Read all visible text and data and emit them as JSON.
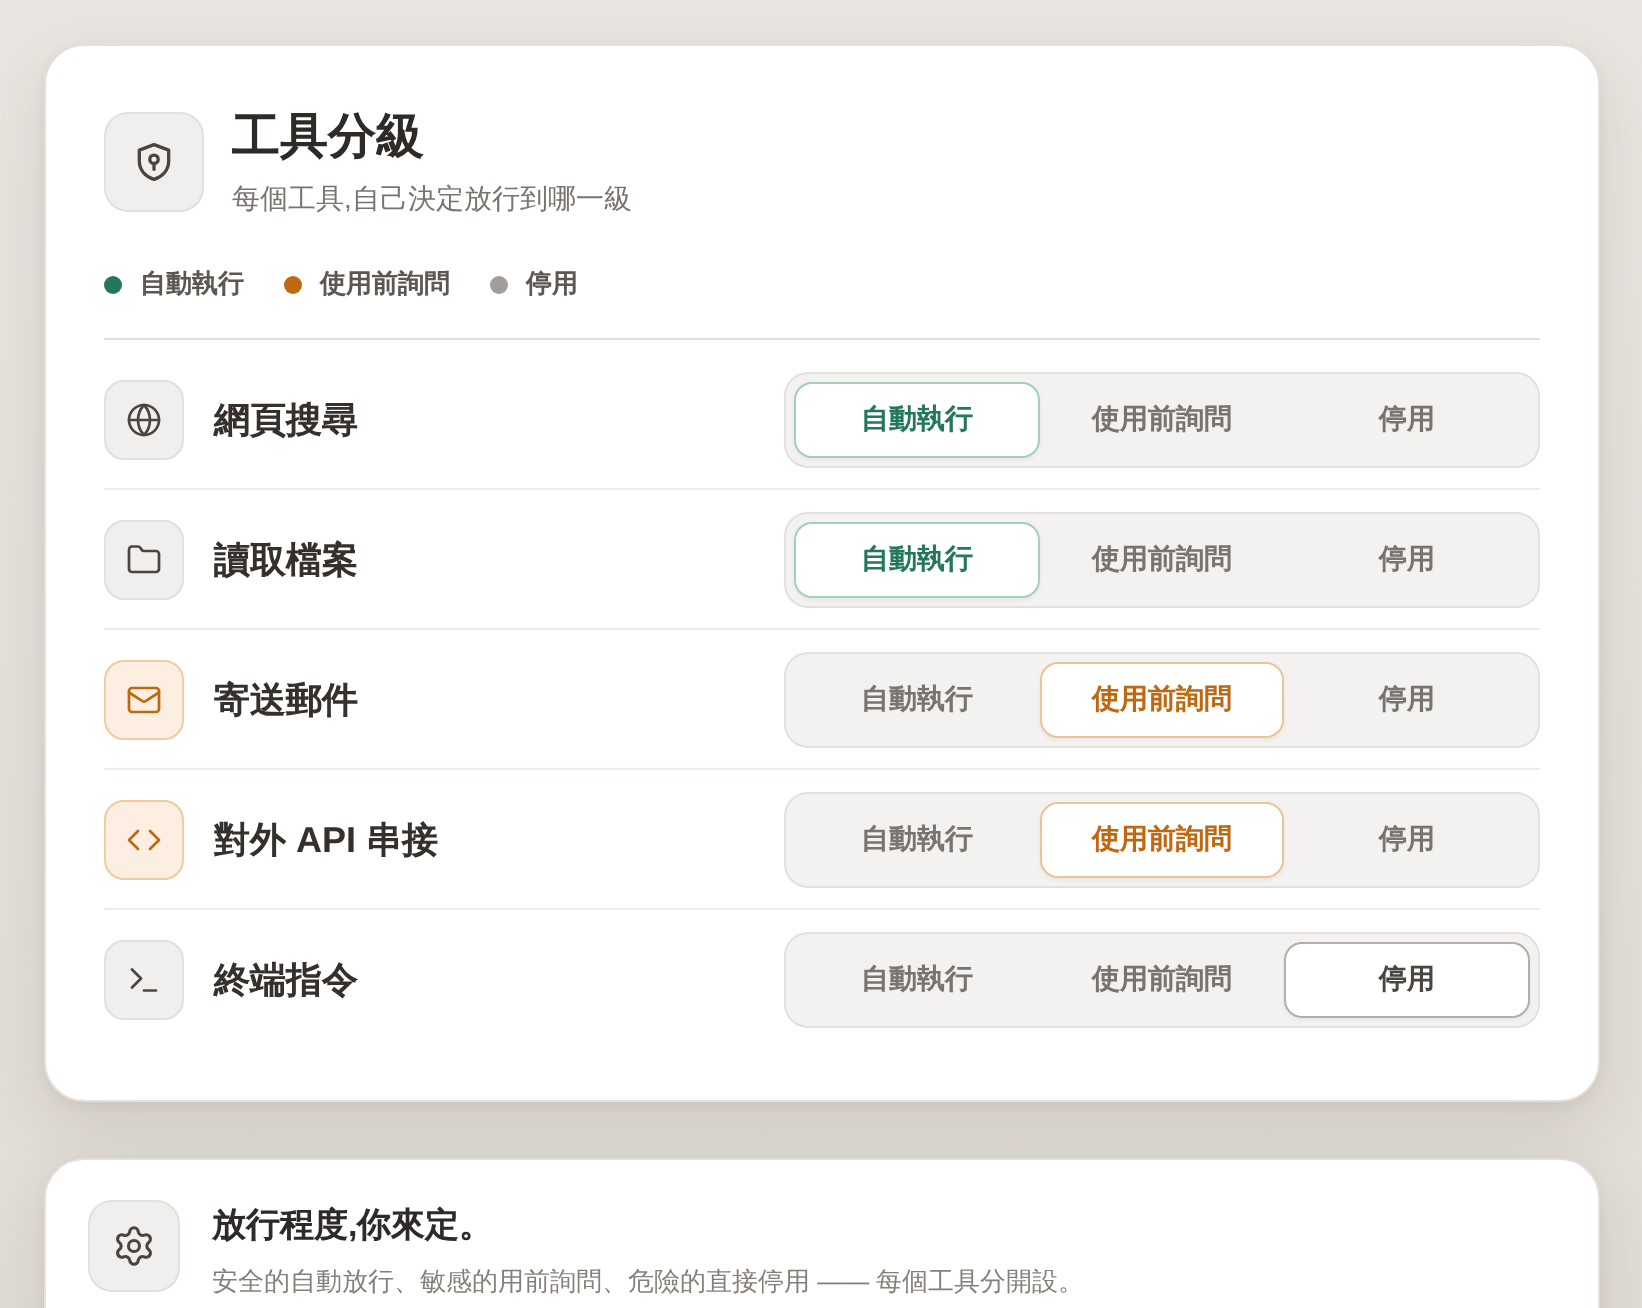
{
  "header": {
    "title": "工具分級",
    "subtitle": "每個工具,自己決定放行到哪一級"
  },
  "legend": [
    {
      "label": "自動執行",
      "color": "#24785a"
    },
    {
      "label": "使用前詢問",
      "color": "#c0680f"
    },
    {
      "label": "停用",
      "color": "#a29d98"
    }
  ],
  "tools": [
    {
      "name": "網頁搜尋",
      "options": [
        {
          "label": "自動執行",
          "kind": "auto",
          "selected": true
        },
        {
          "label": "使用前詢問",
          "kind": "ask",
          "selected": false
        },
        {
          "label": "停用",
          "kind": "off",
          "selected": false
        }
      ]
    },
    {
      "name": "讀取檔案",
      "options": [
        {
          "label": "自動執行",
          "kind": "auto",
          "selected": true
        },
        {
          "label": "使用前詢問",
          "kind": "ask",
          "selected": false
        },
        {
          "label": "停用",
          "kind": "off",
          "selected": false
        }
      ]
    },
    {
      "name": "寄送郵件",
      "options": [
        {
          "label": "自動執行",
          "kind": "auto",
          "selected": false
        },
        {
          "label": "使用前詢問",
          "kind": "ask",
          "selected": true
        },
        {
          "label": "停用",
          "kind": "off",
          "selected": false
        }
      ]
    },
    {
      "name": "對外 API 串接",
      "options": [
        {
          "label": "自動執行",
          "kind": "auto",
          "selected": false
        },
        {
          "label": "使用前詢問",
          "kind": "ask",
          "selected": true
        },
        {
          "label": "停用",
          "kind": "off",
          "selected": false
        }
      ]
    },
    {
      "name": "終端指令",
      "options": [
        {
          "label": "自動執行",
          "kind": "auto",
          "selected": false
        },
        {
          "label": "使用前詢問",
          "kind": "ask",
          "selected": false
        },
        {
          "label": "停用",
          "kind": "off",
          "selected": true
        }
      ]
    }
  ],
  "footer": {
    "title": "放行程度,你來定。",
    "text": "安全的自動放行、敏感的用前詢問、危險的直接停用 —— 每個工具分開設。"
  }
}
